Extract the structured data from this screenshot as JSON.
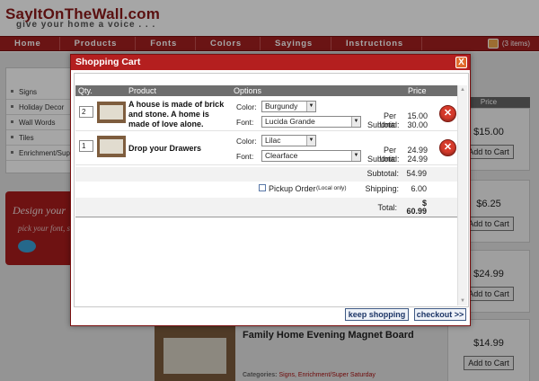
{
  "site": {
    "logo": "SayItOnTheWall.com",
    "tagline": "give your home a voice . . .",
    "nav": [
      "Home",
      "Products",
      "Fonts",
      "Colors",
      "Sayings",
      "Instructions"
    ],
    "cart_count": "(3 items)"
  },
  "sidebar": {
    "items": [
      "Signs",
      "Holiday Decor",
      "Wall Words",
      "Tiles",
      "Enrichment/Super"
    ]
  },
  "design_box": {
    "title": "Design your",
    "subtitle": "pick your font, saying"
  },
  "price_column": {
    "header": "Price",
    "cards": [
      {
        "price": "$15.00",
        "button": "Add to Cart"
      },
      {
        "price": "$6.25",
        "button": "Add to Cart"
      },
      {
        "price": "$24.99",
        "button": "Add to Cart"
      },
      {
        "price": "$14.99",
        "button": "Add to Cart"
      }
    ]
  },
  "background_product": {
    "title": "Family Home Evening Magnet Board",
    "categories_label": "Categories:",
    "categories": "Signs, Enrichment/Super Saturday"
  },
  "modal": {
    "title": "Shopping Cart",
    "close_label": "X",
    "headers": {
      "qty": "Qty.",
      "product": "Product",
      "options": "Options",
      "price": "Price"
    },
    "items": [
      {
        "qty": "2",
        "name": "A house is made of brick and stone. A home is made of love alone.",
        "color_label": "Color:",
        "color": "Burgundy",
        "font_label": "Font:",
        "font": "Lucida Grande",
        "per_unit_label": "Per Unit:",
        "per_unit": "15.00",
        "subtotal_label": "Subtotal:",
        "subtotal": "30.00"
      },
      {
        "qty": "1",
        "name": "Drop your Drawers",
        "color_label": "Color:",
        "color": "Lilac",
        "font_label": "Font:",
        "font": "Clearface",
        "per_unit_label": "Per Unit:",
        "per_unit": "24.99",
        "subtotal_label": "Subtotal:",
        "subtotal": "24.99"
      }
    ],
    "summary": {
      "subtotal_label": "Subtotal:",
      "subtotal": "54.99",
      "pickup_label": "Pickup Order",
      "pickup_note": "(Local only)",
      "shipping_label": "Shipping:",
      "shipping": "6.00",
      "total_label": "Total:",
      "total_currency": "$",
      "total": "60.99"
    },
    "buttons": {
      "keep_shopping": "keep shopping",
      "checkout": "checkout >>"
    }
  }
}
